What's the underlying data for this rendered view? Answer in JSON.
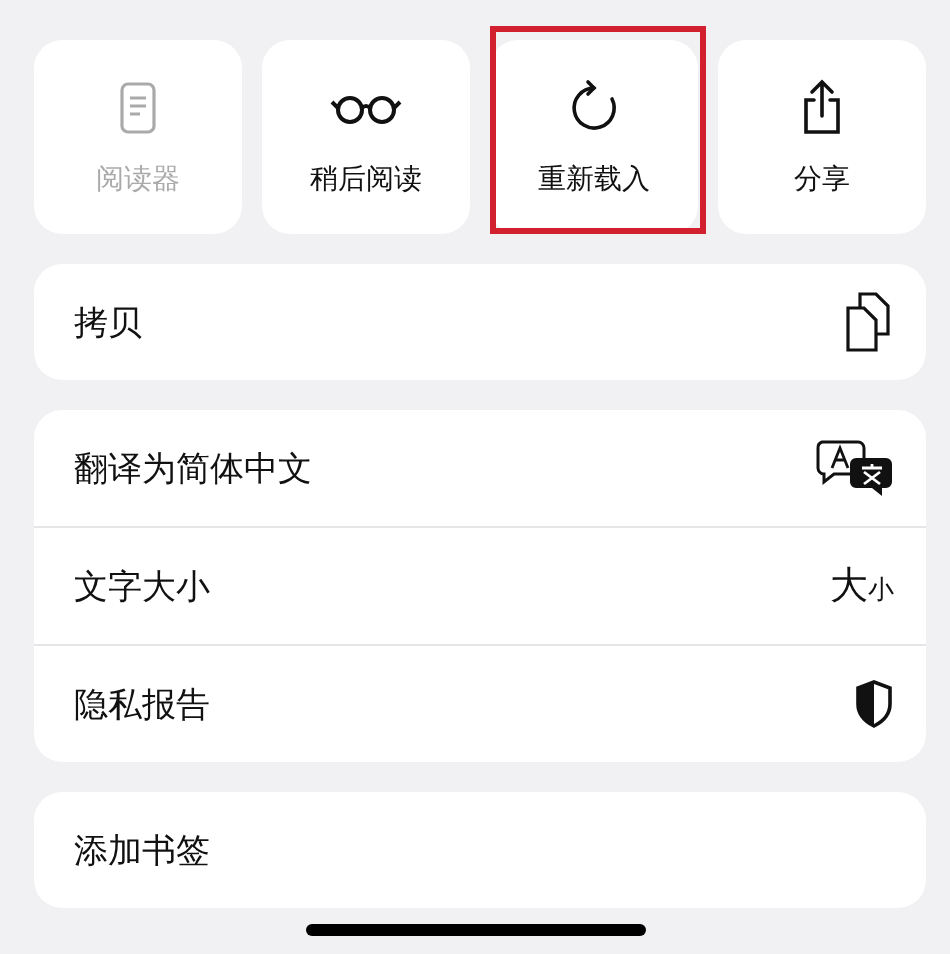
{
  "actions": [
    {
      "label": "阅读器",
      "kind": "reader",
      "disabled": true,
      "highlighted": false
    },
    {
      "label": "稍后阅读",
      "kind": "glasses",
      "disabled": false,
      "highlighted": false
    },
    {
      "label": "重新载入",
      "kind": "reload",
      "disabled": false,
      "highlighted": true
    },
    {
      "label": "分享",
      "kind": "share",
      "disabled": false,
      "highlighted": false
    }
  ],
  "groups": [
    [
      {
        "label": "拷贝",
        "kind": "copy"
      }
    ],
    [
      {
        "label": "翻译为简体中文",
        "kind": "translate"
      },
      {
        "label": "文字大小",
        "kind": "text-size",
        "big": "大",
        "small": "小"
      },
      {
        "label": "隐私报告",
        "kind": "privacy"
      }
    ],
    [
      {
        "label": "添加书签",
        "kind": "plain"
      }
    ]
  ]
}
